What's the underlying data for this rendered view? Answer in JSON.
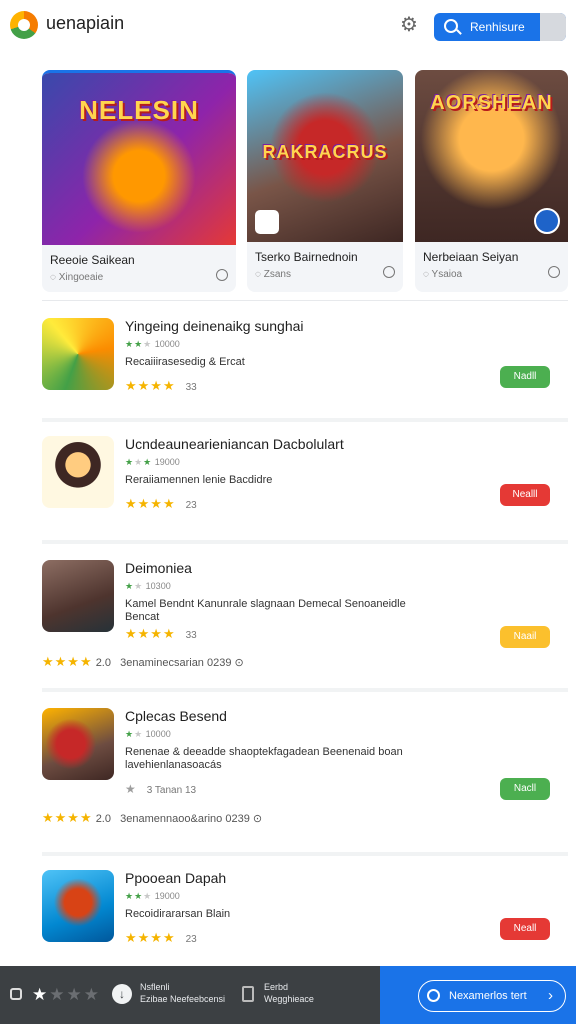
{
  "header": {
    "app_title": "uenapiain",
    "search_label": "Renhisure"
  },
  "featured": [
    {
      "image_title": "NELESIN",
      "name": "Reeoie Saikean",
      "sub": "Xingoeaie"
    },
    {
      "image_title": "RAKRACRUS",
      "name": "Tserko Bairnednoin",
      "sub": "Zsans"
    },
    {
      "image_title": "AORSHEAN",
      "name": "Nerbeiaan Seiyan",
      "sub": "Ysaioa"
    }
  ],
  "apps": [
    {
      "name": "Yingeing deinenaikg sunghai",
      "mini": "10000",
      "desc": "Recaiiirasesedig & Ercat",
      "rating_count": "33",
      "button_label": "Nadll",
      "button_color": "#4caf50"
    },
    {
      "name": "Ucndeaunearieniancan Dacbolulart",
      "mini": "19000",
      "desc": "Reraiiamennen lenie Bacdidre",
      "rating_count": "23",
      "button_label": "Nealll",
      "button_color": "#e53935"
    },
    {
      "name": "Deimoniea",
      "mini": "10300",
      "desc": "Kamel Bendnt Kanunrale slagnaan Demecal Senoaneidle Bencat",
      "rating_count": "33",
      "button_label": "Naail",
      "button_color": "#fbc02d",
      "extra_rating": "2.0",
      "extra_text": "3enaminecsarian 0239"
    },
    {
      "name": "Cplecas Besend",
      "mini": "10000",
      "desc": "Renenae & deeadde shaoptekfagadean Beenenaid boan lavehienlanasoacás",
      "rating_count": "3 Tanan 13",
      "button_label": "Nacll",
      "button_color": "#4caf50",
      "extra_rating": "2.0",
      "extra_text": "3enamennaoo&arino 0239"
    },
    {
      "name": "Ppooean Dapah",
      "mini": "19000",
      "desc": "Recoidirararsan Blain",
      "rating_count": "23",
      "button_label": "Neall",
      "button_color": "#e53935"
    }
  ],
  "bottom_bar": {
    "info1_line1": "Nsflenli",
    "info1_line2": "Ezibae Neefeebcensi",
    "info2_line1": "Eerbd",
    "info2_line2": "Wegghieace",
    "action_label": "Nexamerlos  tert"
  }
}
